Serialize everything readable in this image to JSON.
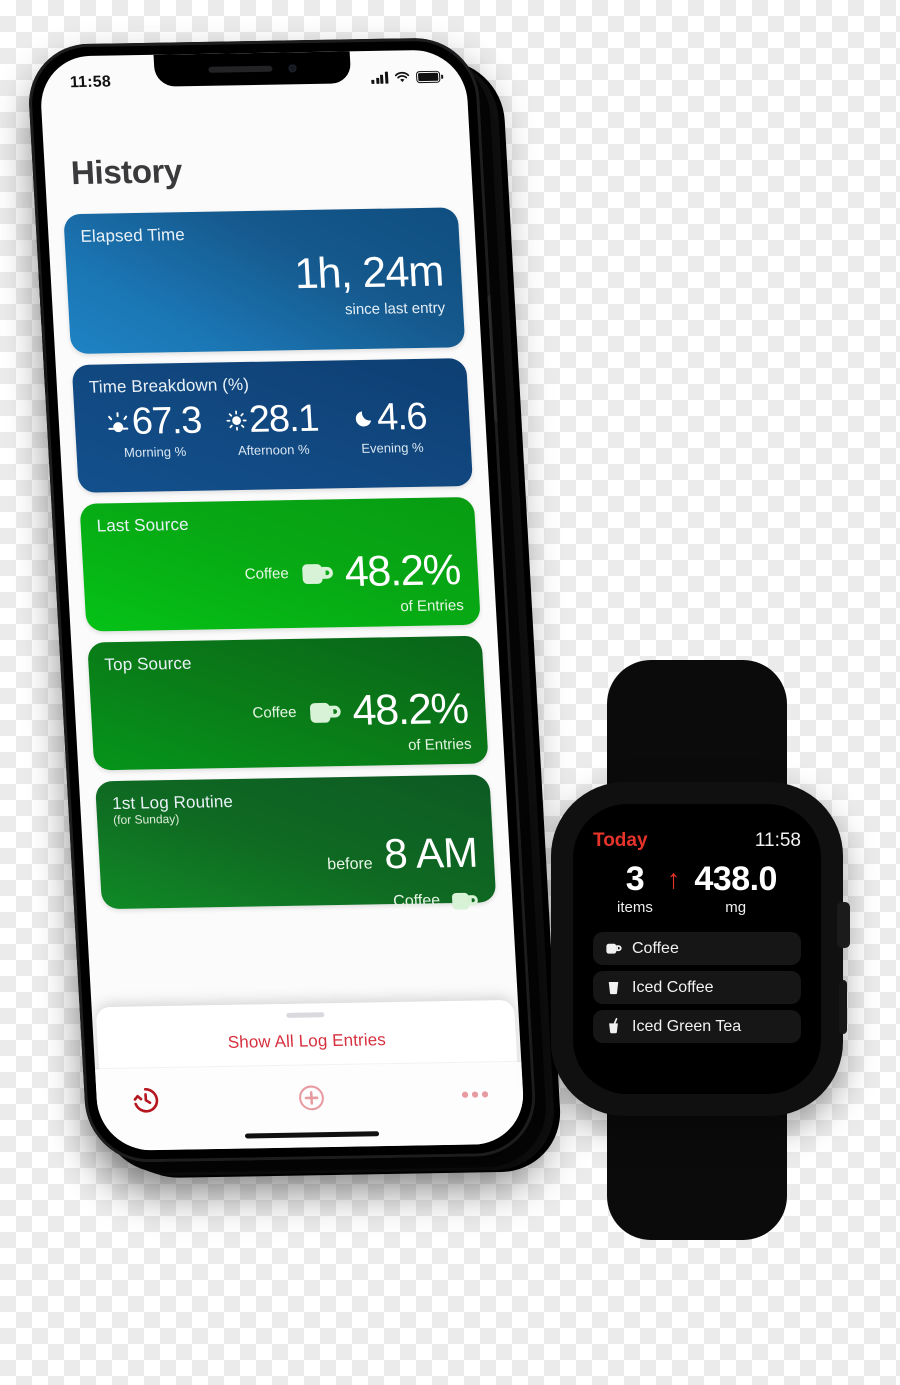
{
  "phone": {
    "status_bar": {
      "time": "11:58",
      "signal_icon": "cellular-signal-icon",
      "wifi_icon": "wifi-icon",
      "battery_icon": "battery-icon"
    },
    "page_title": "History",
    "cards": [
      {
        "id": "elapsed-time",
        "title": "Elapsed Time",
        "value": "1h, 24m",
        "footer": "since last entry"
      },
      {
        "id": "time-breakdown",
        "title": "Time Breakdown (%)",
        "columns": [
          {
            "icon": "sunrise-icon",
            "value": "67.3",
            "label": "Morning %"
          },
          {
            "icon": "sun-icon",
            "value": "28.1",
            "label": "Afternoon %"
          },
          {
            "icon": "moon-icon",
            "value": "4.6",
            "label": "Evening %"
          }
        ]
      },
      {
        "id": "last-source",
        "title": "Last Source",
        "source_name": "Coffee",
        "source_icon": "coffee-mug-icon",
        "value": "48.2%",
        "footer": "of Entries"
      },
      {
        "id": "top-source",
        "title": "Top Source",
        "source_name": "Coffee",
        "source_icon": "coffee-mug-icon",
        "value": "48.2%",
        "footer": "of Entries"
      },
      {
        "id": "first-log-routine",
        "title": "1st Log Routine",
        "subtitle": "(for Sunday)",
        "before_label": "before",
        "value": "8 AM",
        "source_name": "Coffee",
        "source_icon": "coffee-mug-icon"
      }
    ],
    "sheet": {
      "grabber": "sheet-grabber",
      "action_label": "Show All Log Entries"
    },
    "toolbar": [
      {
        "icon": "history-clock-icon",
        "state": "active"
      },
      {
        "icon": "add-plus-circle-icon",
        "state": "inactive"
      },
      {
        "icon": "ellipsis-more-icon",
        "state": "inactive"
      }
    ]
  },
  "watch": {
    "header": {
      "label": "Today",
      "time": "11:58"
    },
    "metrics": [
      {
        "value": "3",
        "unit": "items"
      },
      {
        "value": "438.0",
        "unit": "mg"
      }
    ],
    "trend_icon": "up-arrow-icon",
    "list": [
      {
        "icon": "coffee-mug-icon",
        "label": "Coffee"
      },
      {
        "icon": "iced-cup-icon",
        "label": "Iced Coffee"
      },
      {
        "icon": "straw-cup-icon",
        "label": "Iced Green Tea"
      }
    ]
  },
  "colors": {
    "blue_light": "#1e83c4",
    "blue_dark": "#0d3f73",
    "green_bright": "#05c216",
    "green_mid": "#09641a",
    "green_dark": "#0d5a24",
    "accent_red": "#d7313f",
    "watch_red": "#e7342b"
  }
}
